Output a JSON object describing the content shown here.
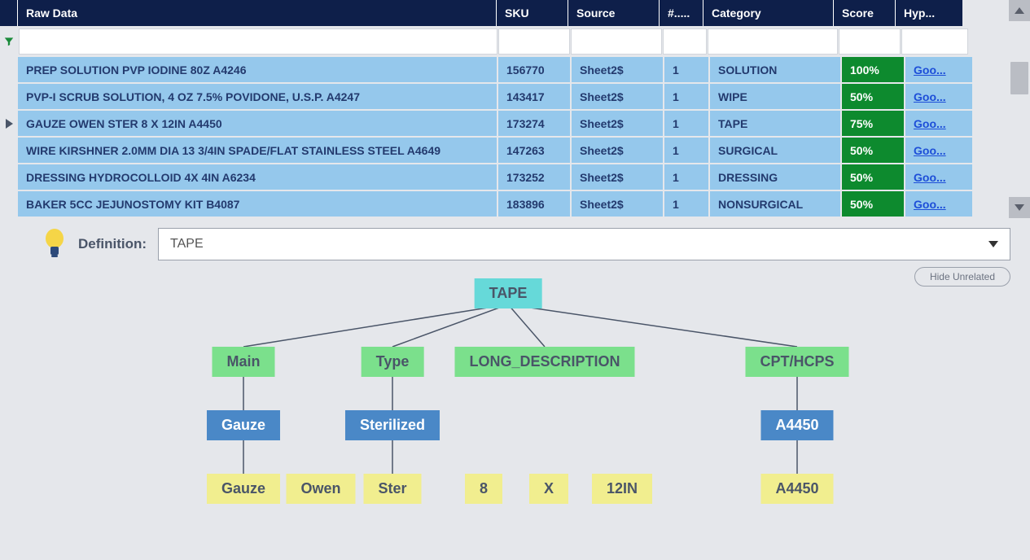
{
  "columns": {
    "raw": "Raw Data",
    "sku": "SKU",
    "source": "Source",
    "count": "#.....",
    "category": "Category",
    "score": "Score",
    "hyp": "Hyp..."
  },
  "rows": [
    {
      "raw": "PREP SOLUTION PVP IODINE 80Z A4246",
      "sku": "156770",
      "source": "Sheet2$",
      "count": "1",
      "category": "SOLUTION",
      "score": "100%",
      "hyp": "Goo...",
      "active": false
    },
    {
      "raw": "PVP-I SCRUB SOLUTION, 4 OZ 7.5% POVIDONE, U.S.P. A4247",
      "sku": "143417",
      "source": "Sheet2$",
      "count": "1",
      "category": "WIPE",
      "score": "50%",
      "hyp": "Goo...",
      "active": false
    },
    {
      "raw": "GAUZE OWEN STER 8 X 12IN A4450",
      "sku": "173274",
      "source": "Sheet2$",
      "count": "1",
      "category": "TAPE",
      "score": "75%",
      "hyp": "Goo...",
      "active": true
    },
    {
      "raw": "WIRE KIRSHNER 2.0MM DIA 13 3/4IN SPADE/FLAT STAINLESS STEEL A4649",
      "sku": "147263",
      "source": "Sheet2$",
      "count": "1",
      "category": "SURGICAL",
      "score": "50%",
      "hyp": "Goo...",
      "active": false
    },
    {
      "raw": "DRESSING HYDROCOLLOID 4X 4IN A6234",
      "sku": "173252",
      "source": "Sheet2$",
      "count": "1",
      "category": "DRESSING",
      "score": "50%",
      "hyp": "Goo...",
      "active": false
    },
    {
      "raw": "BAKER 5CC JEJUNOSTOMY KIT B4087",
      "sku": "183896",
      "source": "Sheet2$",
      "count": "1",
      "category": "NONSURGICAL",
      "score": "50%",
      "hyp": "Goo...",
      "active": false
    }
  ],
  "definition": {
    "label": "Definition:",
    "value": "TAPE",
    "hide_btn": "Hide Unrelated"
  },
  "tree": {
    "root": "TAPE",
    "cats": [
      "Main",
      "Type",
      "LONG_DESCRIPTION",
      "CPT/HCPS"
    ],
    "main_val": "Gauze",
    "type_val": "Sterilized",
    "cpt_val": "A4450",
    "leaves": [
      "Gauze",
      "Owen",
      "Ster",
      "8",
      "X",
      "12IN",
      "A4450"
    ]
  }
}
